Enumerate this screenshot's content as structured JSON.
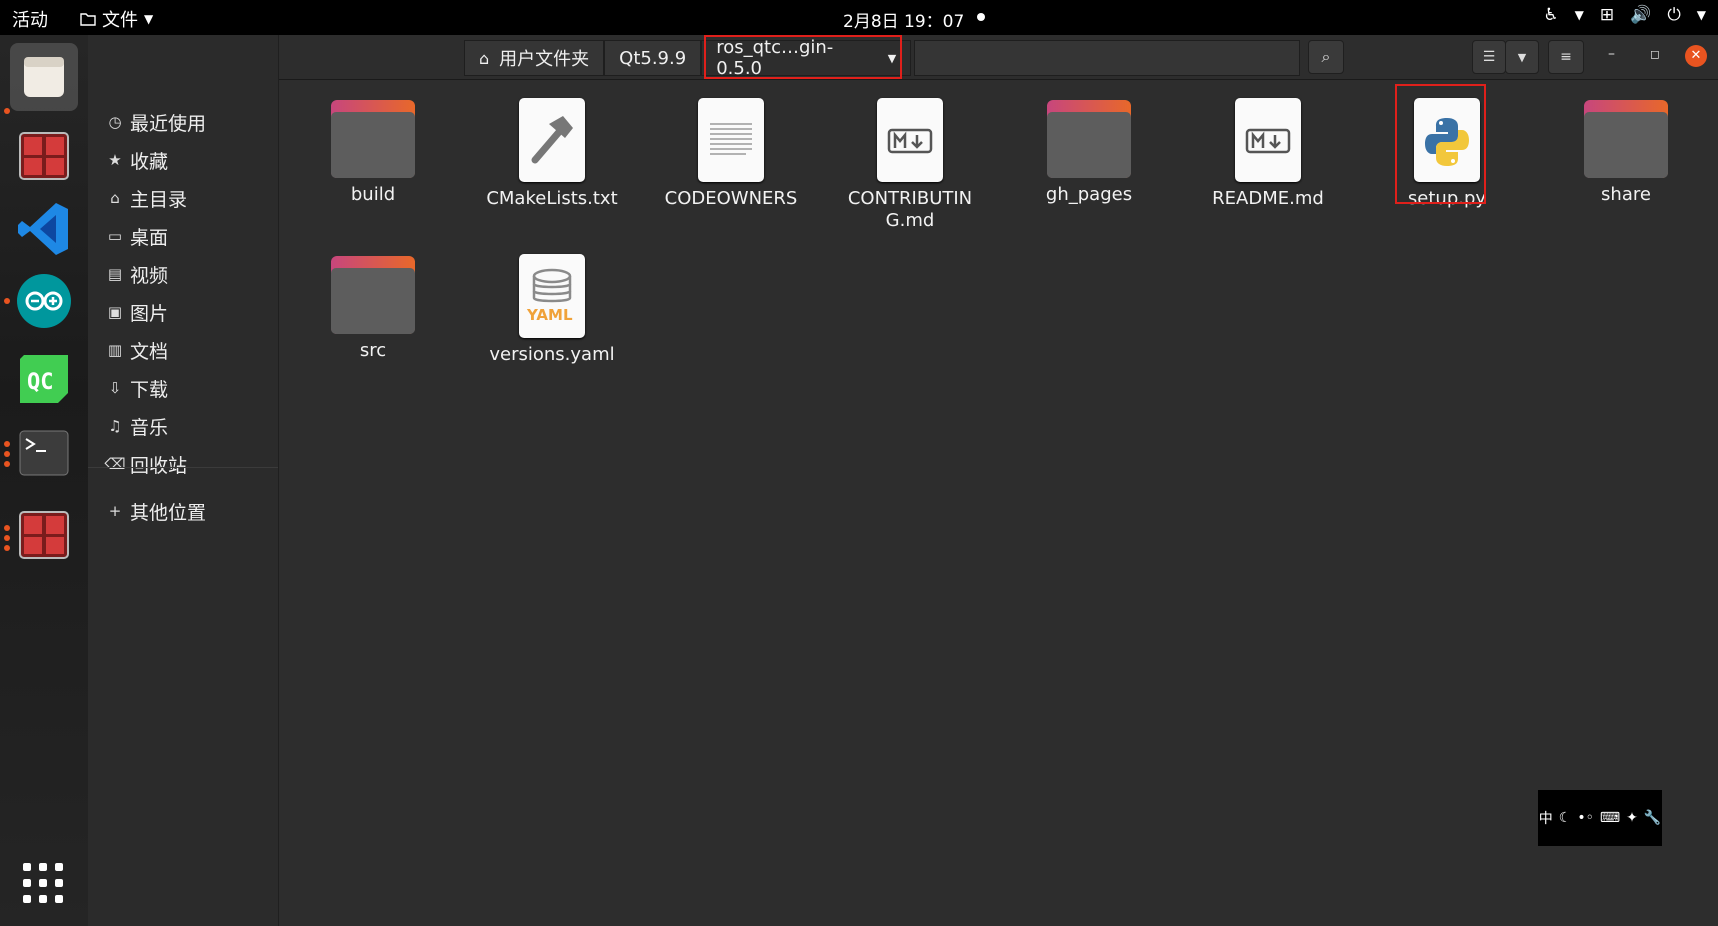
{
  "topbar": {
    "activities": "活动",
    "files_menu": "文件",
    "clock": "2月8日  19：07"
  },
  "breadcrumbs": [
    "用户文件夹",
    "Qt5.9.9",
    "ros_qtc…gin-0.5.0"
  ],
  "sidebar": {
    "items": [
      {
        "label": "最近使用",
        "icon": "clock-icon",
        "glyph": "◷"
      },
      {
        "label": "收藏",
        "icon": "star-icon",
        "glyph": "★"
      },
      {
        "label": "主目录",
        "icon": "home-icon",
        "glyph": "⌂"
      },
      {
        "label": "桌面",
        "icon": "desktop-icon",
        "glyph": "▭"
      },
      {
        "label": "视频",
        "icon": "video-icon",
        "glyph": "▤"
      },
      {
        "label": "图片",
        "icon": "image-icon",
        "glyph": "▣"
      },
      {
        "label": "文档",
        "icon": "document-icon",
        "glyph": "▥"
      },
      {
        "label": "下载",
        "icon": "download-icon",
        "glyph": "⇩"
      },
      {
        "label": "音乐",
        "icon": "music-icon",
        "glyph": "♫"
      },
      {
        "label": "回收站",
        "icon": "trash-icon",
        "glyph": "🗑"
      }
    ],
    "other": "其他位置"
  },
  "files": [
    {
      "name": "build",
      "kind": "folder"
    },
    {
      "name": "CMakeLists.txt",
      "kind": "cmake"
    },
    {
      "name": "CODEOWNERS",
      "kind": "text"
    },
    {
      "name": "CONTRIBUTING.md",
      "kind": "markdown"
    },
    {
      "name": "gh_pages",
      "kind": "folder"
    },
    {
      "name": "README.md",
      "kind": "markdown"
    },
    {
      "name": "setup.py",
      "kind": "python"
    },
    {
      "name": "share",
      "kind": "folder"
    },
    {
      "name": "src",
      "kind": "folder"
    },
    {
      "name": "versions.yaml",
      "kind": "yaml"
    }
  ],
  "ime": {
    "label": "中"
  },
  "colors": {
    "highlight": "#e0201b",
    "accent": "#e95420"
  }
}
